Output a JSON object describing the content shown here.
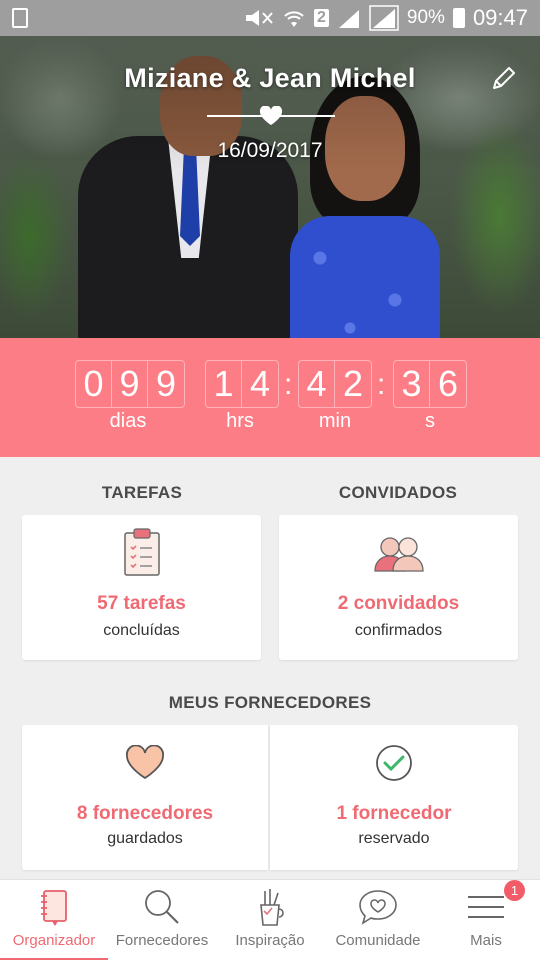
{
  "status_bar": {
    "battery": "90%",
    "time": "09:47",
    "sim_badge": "2"
  },
  "hero": {
    "couple_name": "Miziane & Jean Michel",
    "wedding_date": "16/09/2017",
    "edit_icon": "pencil-icon"
  },
  "countdown": {
    "days": [
      "0",
      "9",
      "9"
    ],
    "hours": [
      "1",
      "4"
    ],
    "minutes": [
      "4",
      "2"
    ],
    "seconds": [
      "3",
      "6"
    ],
    "separator": ":",
    "labels": {
      "days": "dias",
      "hours": "hrs",
      "minutes": "min",
      "seconds": "s"
    }
  },
  "sections": {
    "tasks_title": "TAREFAS",
    "guests_title": "CONVIDADOS",
    "vendors_title": "MEUS FORNECEDORES"
  },
  "cards": {
    "tasks": {
      "count": "57 tarefas",
      "sub": "concluídas",
      "icon": "clipboard-checklist-icon"
    },
    "guests": {
      "count": "2 convidados",
      "sub": "confirmados",
      "icon": "guests-icon"
    },
    "saved_vendors": {
      "count": "8 fornecedores",
      "sub": "guardados",
      "icon": "heart-icon"
    },
    "booked_vendors": {
      "count": "1 fornecedor",
      "sub": "reservado",
      "icon": "check-circle-icon"
    }
  },
  "bottom_nav": {
    "items": [
      {
        "label": "Organizador",
        "icon": "notebook-icon",
        "active": true
      },
      {
        "label": "Fornecedores",
        "icon": "search-icon",
        "active": false
      },
      {
        "label": "Inspiração",
        "icon": "pencil-cup-icon",
        "active": false
      },
      {
        "label": "Comunidade",
        "icon": "chat-heart-icon",
        "active": false
      },
      {
        "label": "Mais",
        "icon": "menu-icon",
        "active": false
      }
    ],
    "more_badge": "1"
  },
  "colors": {
    "accent": "#fc7d86",
    "accent_text": "#ef6a73",
    "status_bar": "#9e9e9e"
  }
}
